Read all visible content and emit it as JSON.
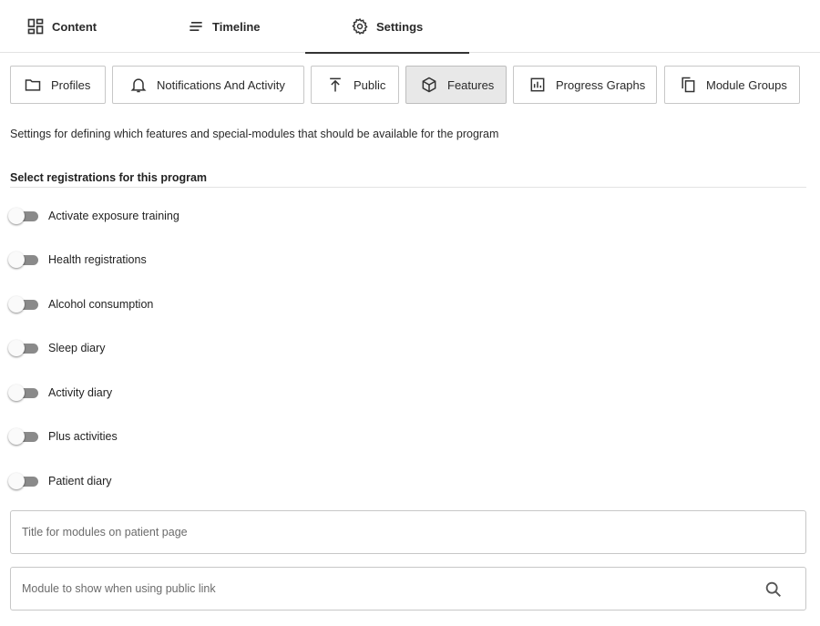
{
  "tabs": [
    {
      "label": "Content",
      "icon": "dashboard-icon"
    },
    {
      "label": "Timeline",
      "icon": "notes-icon"
    },
    {
      "label": "Settings",
      "icon": "gear-icon",
      "active": true
    }
  ],
  "subnav": [
    {
      "label": "Profiles",
      "icon": "folder-icon"
    },
    {
      "label": "Notifications And Activity",
      "icon": "bell-icon"
    },
    {
      "label": "Public",
      "icon": "publish-icon"
    },
    {
      "label": "Features",
      "icon": "cube-icon",
      "active": true
    },
    {
      "label": "Progress Graphs",
      "icon": "bar-chart-icon"
    },
    {
      "label": "Module Groups",
      "icon": "copy-icon"
    }
  ],
  "description": "Settings for defining which features and special-modules that should be available for the program",
  "section_title": "Select registrations for this program",
  "toggles": [
    {
      "label": "Activate exposure training",
      "checked": false
    },
    {
      "label": "Health registrations",
      "checked": false
    },
    {
      "label": "Alcohol consumption",
      "checked": false
    },
    {
      "label": "Sleep diary",
      "checked": false
    },
    {
      "label": "Activity diary",
      "checked": false
    },
    {
      "label": "Plus activities",
      "checked": false
    },
    {
      "label": "Patient diary",
      "checked": false
    }
  ],
  "fields": {
    "modules_title": {
      "placeholder": "Title for modules on patient page",
      "value": ""
    },
    "public_module": {
      "placeholder": "Module to show when using public link",
      "value": "",
      "icon": "search-icon"
    }
  },
  "colors": {
    "active_tab_underline": "#333333",
    "active_button_bg": "#e8e8e8",
    "switch_track": "#8a8a8a"
  }
}
